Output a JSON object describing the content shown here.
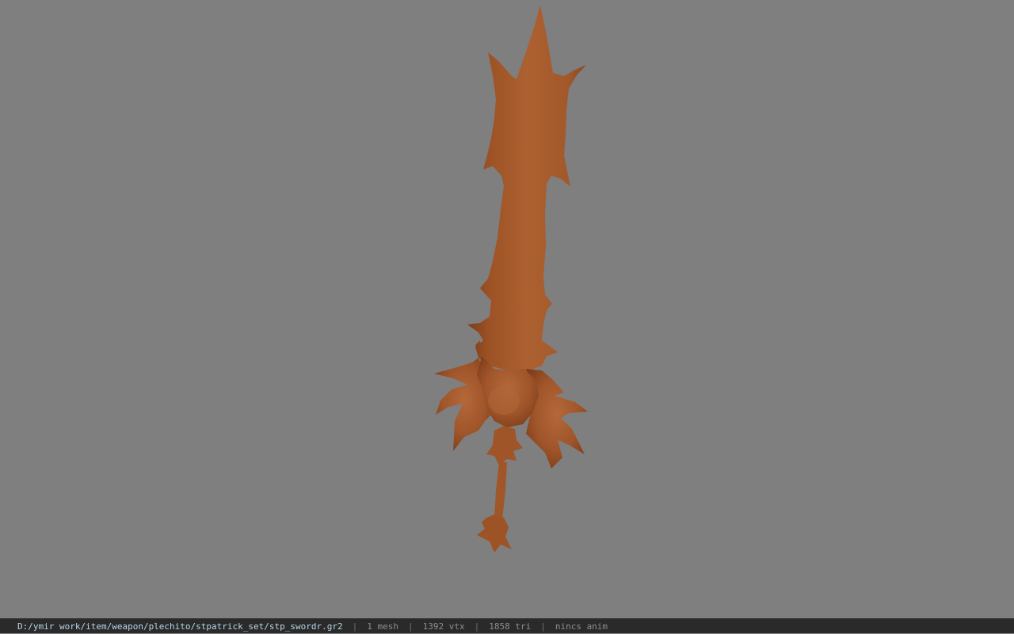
{
  "viewport": {
    "background_color": "#7f7f7f",
    "model_color": "#a85a2a"
  },
  "statusbar": {
    "file_path": "D:/ymir work/item/weapon/plechito/stpatrick_set/stp_swordr.gr2",
    "separator": "|",
    "mesh_count": "1 mesh",
    "vertex_count": "1392 vtx",
    "triangle_count": "1858 tri",
    "anim_status": "nincs anim"
  }
}
